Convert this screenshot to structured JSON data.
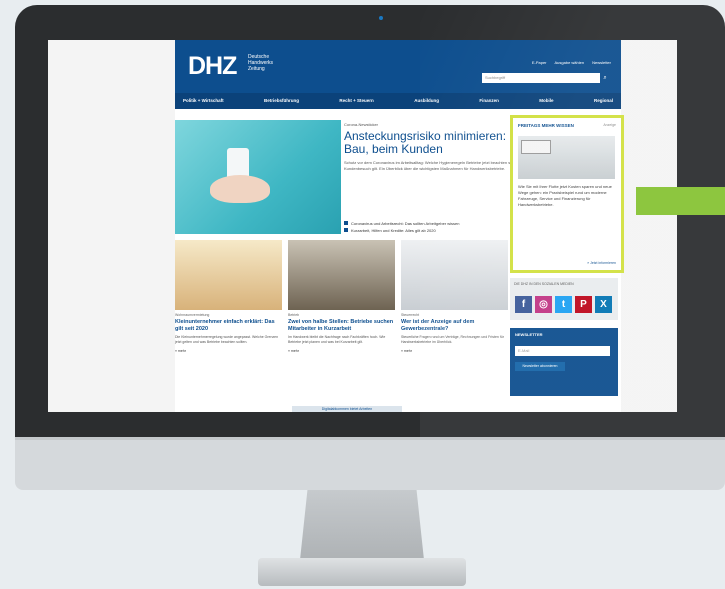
{
  "site": {
    "logo": "DHZ",
    "logo_sub": "Deutsche Handwerks Zeitung",
    "top_links": [
      "E-Paper",
      "Ausgabe wählen",
      "Newsletter"
    ],
    "search_placeholder": "Suchbegriff",
    "nav": [
      "Politik + Wirtschaft",
      "Betriebsführung",
      "Recht + Steuern",
      "Ausbildung",
      "Finanzen",
      "Mobile",
      "Regional"
    ]
  },
  "hero": {
    "kicker": "Corona-Newsticker",
    "title": "Ansteckungsrisiko minimieren: Im Betrieb, auf dem Bau, beim Kunden",
    "text": "Schutz vor dem Coronavirus im Arbeitsalltag: Welche Hygieneregeln Betriebe jetzt beachten sollten, wie Mitarbeiter geschützt werden und was beim Kundenbesuch gilt. Ein Überblick über die wichtigsten Maßnahmen für Handwerksbetriebe.",
    "links": [
      "Coronavirus und Arbeitsrecht: Das sollten Arbeitgeber wissen",
      "Kurzarbeit, Hilfen und Kredite: Alles gilt ab 2020"
    ]
  },
  "sidebar": {
    "title": "FREITAGS MEHR WISSEN",
    "small": "Anzeige",
    "text": "Wie Sie mit Ihrer Flotte jetzt Kosten sparen und neue Wege gehen: ein Praxisbeispiel rund um moderne Fahrzeuge, Service und Finanzierung für Handwerksbetriebe.",
    "link": "» Jetzt informieren"
  },
  "social": {
    "title": "DIE DHZ IN DEN SOZIALEN MEDIEN",
    "icons": [
      "f",
      "◎",
      "t",
      "P",
      "X"
    ],
    "colors": [
      "#3b5998",
      "#c13584",
      "#1da1f2",
      "#bd081c",
      "#0274b3"
    ]
  },
  "newsletter": {
    "title": "NEWSLETTER",
    "placeholder": "E-Mail",
    "button": "Newsletter abonnieren"
  },
  "cards": [
    {
      "kicker": "Wohnraumvermietung",
      "title": "Kleinunternehmer einfach erklärt: Das gilt seit 2020",
      "text": "Die Kleinunternehmerregelung wurde angepasst. Welche Grenzen jetzt gelten und was Betriebe beachten sollten.",
      "more": "» mehr"
    },
    {
      "kicker": "Betrieb",
      "title": "Zwei von halbe Stellen: Betriebe suchen Mitarbeiter in Kurzarbeit",
      "text": "Im Handwerk bleibt die Nachfrage nach Fachkräften hoch. Wie Betriebe jetzt planen und was bei Kurzarbeit gilt.",
      "more": "» mehr"
    },
    {
      "kicker": "Steuerrecht",
      "title": "Wer ist der Anzeige auf dem Gewerbezentrale?",
      "text": "Steuerliche Fragen rund um Verträge, Rechnungen und Fristen für Handwerksbetriebe im Überblick.",
      "more": "» mehr"
    }
  ],
  "ad_banner": "Digitalabkommen bietet Arbeiten"
}
